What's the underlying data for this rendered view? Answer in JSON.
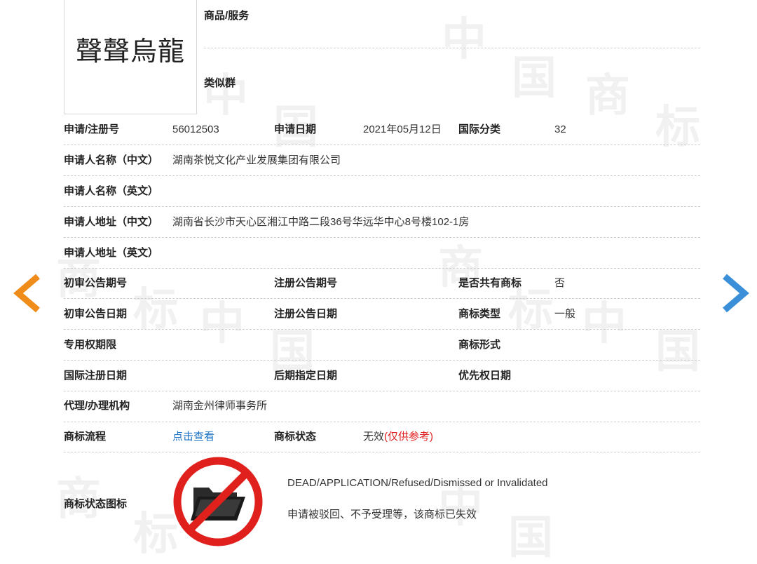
{
  "watermark": {
    "chars": [
      "中",
      "国",
      "商",
      "标"
    ]
  },
  "logo": {
    "text": "聲聲烏龍"
  },
  "top": {
    "goods_label": "商品/服务",
    "similar_group_label": "类似群"
  },
  "rows": {
    "reg": {
      "l1": "申请/注册号",
      "v1": "56012503",
      "l2": "申请日期",
      "v2": "2021年05月12日",
      "l3": "国际分类",
      "v3": "32"
    },
    "applicant_cn": {
      "label": "申请人名称（中文）",
      "value": "湖南茶悦文化产业发展集团有限公司"
    },
    "applicant_en": {
      "label": "申请人名称（英文）",
      "value": ""
    },
    "address_cn": {
      "label": "申请人地址（中文）",
      "value": "湖南省长沙市天心区湘江中路二段36号华远华中心8号楼102-1房"
    },
    "address_en": {
      "label": "申请人地址（英文）",
      "value": ""
    },
    "prelim_no": {
      "l1": "初审公告期号",
      "v1": "",
      "l2": "注册公告期号",
      "v2": "",
      "l3": "是否共有商标",
      "v3": "否"
    },
    "prelim_date": {
      "l1": "初审公告日期",
      "v1": "",
      "l2": "注册公告日期",
      "v2": "",
      "l3": "商标类型",
      "v3": "一般"
    },
    "exclusive": {
      "l1": "专用权期限",
      "v1": "",
      "l3": "商标形式",
      "v3": ""
    },
    "intl_reg": {
      "l1": "国际注册日期",
      "v1": "",
      "l2": "后期指定日期",
      "v2": "",
      "l3": "优先权日期",
      "v3": ""
    },
    "agent": {
      "label": "代理/办理机构",
      "value": "湖南金州律师事务所"
    },
    "flow": {
      "l1": "商标流程",
      "link": "点击查看",
      "l2": "商标状态",
      "status": "无效",
      "note": "(仅供参考)"
    }
  },
  "status_icon": {
    "label": "商标状态图标",
    "icon": "prohibited-folder-icon",
    "desc_en": "DEAD/APPLICATION/Refused/Dismissed or Invalidated",
    "desc_cn": "申请被驳回、不予受理等，该商标已失效"
  },
  "nav": {
    "prev_icon": "arrow-left-icon",
    "next_icon": "arrow-right-icon"
  },
  "colors": {
    "prev_arrow": "#f08c1a",
    "next_arrow": "#3b8fd9",
    "link": "#1a73c7",
    "warning": "#e02020",
    "prohibit": "#e0201c"
  }
}
